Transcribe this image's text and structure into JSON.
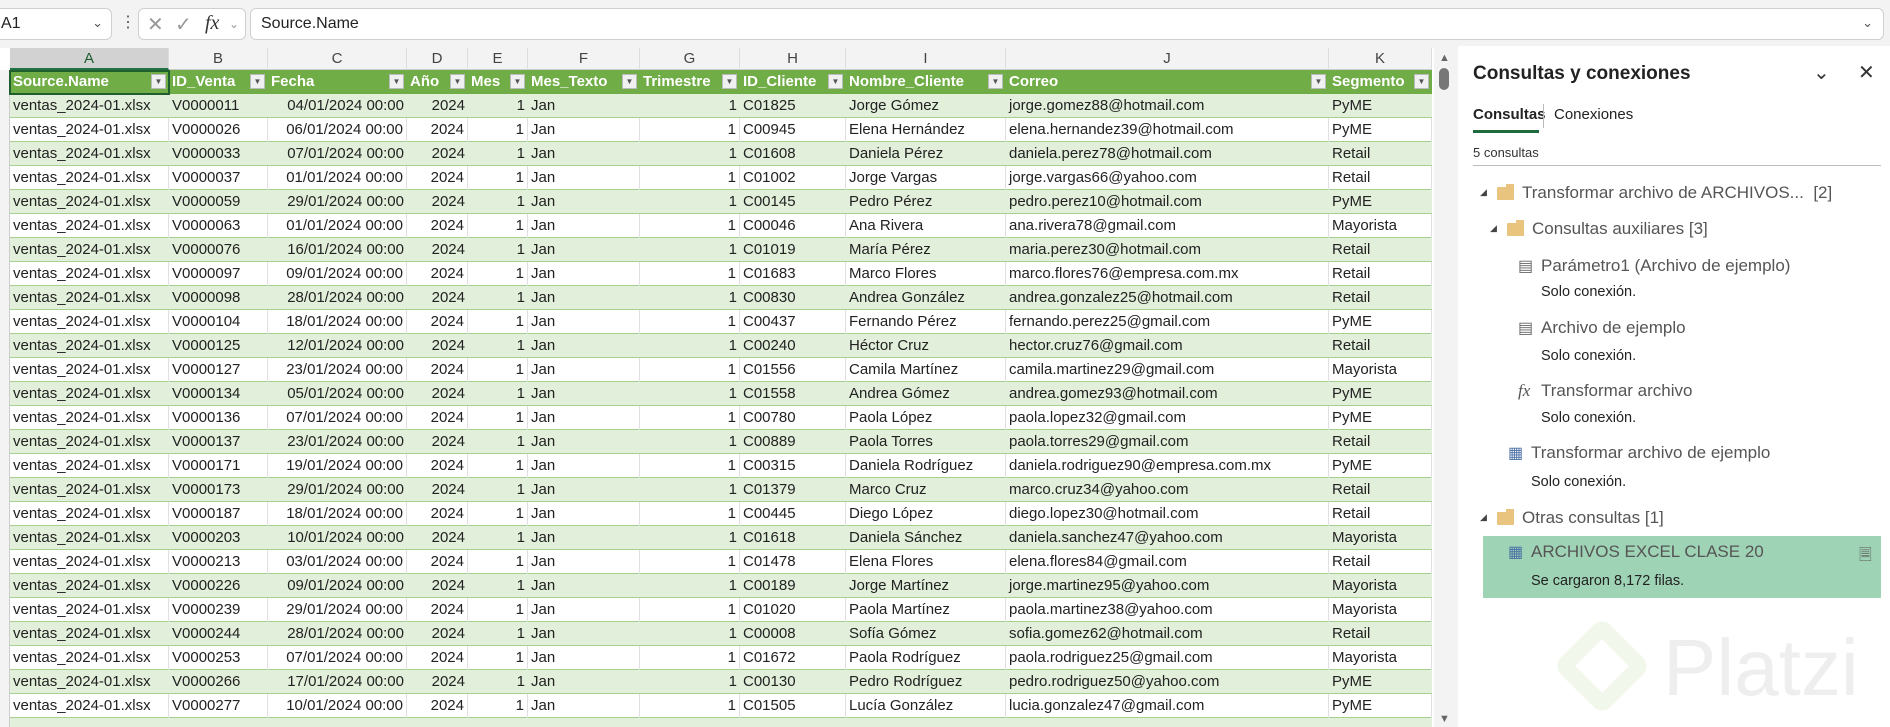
{
  "formula_bar": {
    "name_box": "A1",
    "cancel_icon": "✕",
    "enter_icon": "✓",
    "fx": "fx",
    "formula": "Source.Name"
  },
  "column_letters": [
    "A",
    "B",
    "C",
    "D",
    "E",
    "F",
    "G",
    "H",
    "I",
    "J",
    "K"
  ],
  "table": {
    "headers": [
      "Source.Name",
      "ID_Venta",
      "Fecha",
      "Año",
      "Mes",
      "Mes_Texto",
      "Trimestre",
      "ID_Cliente",
      "Nombre_Cliente",
      "Correo",
      "Segmento"
    ],
    "rows": [
      [
        "ventas_2024-01.xlsx",
        "V0000011",
        "04/01/2024 00:00",
        "2024",
        "1",
        "Jan",
        "1",
        "C01825",
        "Jorge Gómez",
        "jorge.gomez88@hotmail.com",
        "PyME"
      ],
      [
        "ventas_2024-01.xlsx",
        "V0000026",
        "06/01/2024 00:00",
        "2024",
        "1",
        "Jan",
        "1",
        "C00945",
        "Elena Hernández",
        "elena.hernandez39@hotmail.com",
        "PyME"
      ],
      [
        "ventas_2024-01.xlsx",
        "V0000033",
        "07/01/2024 00:00",
        "2024",
        "1",
        "Jan",
        "1",
        "C01608",
        "Daniela Pérez",
        "daniela.perez78@hotmail.com",
        "Retail"
      ],
      [
        "ventas_2024-01.xlsx",
        "V0000037",
        "01/01/2024 00:00",
        "2024",
        "1",
        "Jan",
        "1",
        "C01002",
        "Jorge Vargas",
        "jorge.vargas66@yahoo.com",
        "Retail"
      ],
      [
        "ventas_2024-01.xlsx",
        "V0000059",
        "29/01/2024 00:00",
        "2024",
        "1",
        "Jan",
        "1",
        "C00145",
        "Pedro Pérez",
        "pedro.perez10@hotmail.com",
        "PyME"
      ],
      [
        "ventas_2024-01.xlsx",
        "V0000063",
        "01/01/2024 00:00",
        "2024",
        "1",
        "Jan",
        "1",
        "C00046",
        "Ana Rivera",
        "ana.rivera78@gmail.com",
        "Mayorista"
      ],
      [
        "ventas_2024-01.xlsx",
        "V0000076",
        "16/01/2024 00:00",
        "2024",
        "1",
        "Jan",
        "1",
        "C01019",
        "María Pérez",
        "maria.perez30@hotmail.com",
        "Retail"
      ],
      [
        "ventas_2024-01.xlsx",
        "V0000097",
        "09/01/2024 00:00",
        "2024",
        "1",
        "Jan",
        "1",
        "C01683",
        "Marco Flores",
        "marco.flores76@empresa.com.mx",
        "Retail"
      ],
      [
        "ventas_2024-01.xlsx",
        "V0000098",
        "28/01/2024 00:00",
        "2024",
        "1",
        "Jan",
        "1",
        "C00830",
        "Andrea González",
        "andrea.gonzalez25@hotmail.com",
        "Retail"
      ],
      [
        "ventas_2024-01.xlsx",
        "V0000104",
        "18/01/2024 00:00",
        "2024",
        "1",
        "Jan",
        "1",
        "C00437",
        "Fernando Pérez",
        "fernando.perez25@gmail.com",
        "PyME"
      ],
      [
        "ventas_2024-01.xlsx",
        "V0000125",
        "12/01/2024 00:00",
        "2024",
        "1",
        "Jan",
        "1",
        "C00240",
        "Héctor Cruz",
        "hector.cruz76@gmail.com",
        "Retail"
      ],
      [
        "ventas_2024-01.xlsx",
        "V0000127",
        "23/01/2024 00:00",
        "2024",
        "1",
        "Jan",
        "1",
        "C01556",
        "Camila Martínez",
        "camila.martinez29@gmail.com",
        "Mayorista"
      ],
      [
        "ventas_2024-01.xlsx",
        "V0000134",
        "05/01/2024 00:00",
        "2024",
        "1",
        "Jan",
        "1",
        "C01558",
        "Andrea Gómez",
        "andrea.gomez93@hotmail.com",
        "PyME"
      ],
      [
        "ventas_2024-01.xlsx",
        "V0000136",
        "07/01/2024 00:00",
        "2024",
        "1",
        "Jan",
        "1",
        "C00780",
        "Paola López",
        "paola.lopez32@gmail.com",
        "PyME"
      ],
      [
        "ventas_2024-01.xlsx",
        "V0000137",
        "23/01/2024 00:00",
        "2024",
        "1",
        "Jan",
        "1",
        "C00889",
        "Paola Torres",
        "paola.torres29@gmail.com",
        "Retail"
      ],
      [
        "ventas_2024-01.xlsx",
        "V0000171",
        "19/01/2024 00:00",
        "2024",
        "1",
        "Jan",
        "1",
        "C00315",
        "Daniela Rodríguez",
        "daniela.rodriguez90@empresa.com.mx",
        "PyME"
      ],
      [
        "ventas_2024-01.xlsx",
        "V0000173",
        "29/01/2024 00:00",
        "2024",
        "1",
        "Jan",
        "1",
        "C01379",
        "Marco Cruz",
        "marco.cruz34@yahoo.com",
        "Retail"
      ],
      [
        "ventas_2024-01.xlsx",
        "V0000187",
        "18/01/2024 00:00",
        "2024",
        "1",
        "Jan",
        "1",
        "C00445",
        "Diego López",
        "diego.lopez30@hotmail.com",
        "Retail"
      ],
      [
        "ventas_2024-01.xlsx",
        "V0000203",
        "10/01/2024 00:00",
        "2024",
        "1",
        "Jan",
        "1",
        "C01618",
        "Daniela Sánchez",
        "daniela.sanchez47@yahoo.com",
        "Mayorista"
      ],
      [
        "ventas_2024-01.xlsx",
        "V0000213",
        "03/01/2024 00:00",
        "2024",
        "1",
        "Jan",
        "1",
        "C01478",
        "Elena Flores",
        "elena.flores84@gmail.com",
        "Retail"
      ],
      [
        "ventas_2024-01.xlsx",
        "V0000226",
        "09/01/2024 00:00",
        "2024",
        "1",
        "Jan",
        "1",
        "C00189",
        "Jorge Martínez",
        "jorge.martinez95@yahoo.com",
        "Mayorista"
      ],
      [
        "ventas_2024-01.xlsx",
        "V0000239",
        "29/01/2024 00:00",
        "2024",
        "1",
        "Jan",
        "1",
        "C01020",
        "Paola Martínez",
        "paola.martinez38@yahoo.com",
        "Mayorista"
      ],
      [
        "ventas_2024-01.xlsx",
        "V0000244",
        "28/01/2024 00:00",
        "2024",
        "1",
        "Jan",
        "1",
        "C00008",
        "Sofía Gómez",
        "sofia.gomez62@hotmail.com",
        "Retail"
      ],
      [
        "ventas_2024-01.xlsx",
        "V0000253",
        "07/01/2024 00:00",
        "2024",
        "1",
        "Jan",
        "1",
        "C01672",
        "Paola Rodríguez",
        "paola.rodriguez25@gmail.com",
        "Mayorista"
      ],
      [
        "ventas_2024-01.xlsx",
        "V0000266",
        "17/01/2024 00:00",
        "2024",
        "1",
        "Jan",
        "1",
        "C00130",
        "Pedro Rodríguez",
        "pedro.rodriguez50@yahoo.com",
        "PyME"
      ],
      [
        "ventas_2024-01.xlsx",
        "V0000277",
        "10/01/2024 00:00",
        "2024",
        "1",
        "Jan",
        "1",
        "C01505",
        "Lucía González",
        "lucia.gonzalez47@gmail.com",
        "PyME"
      ]
    ]
  },
  "panel": {
    "title": "Consultas y conexiones",
    "tabs": [
      "Consultas",
      "Conexiones"
    ],
    "count": "5 consultas",
    "groups": {
      "g1": {
        "label": "Transformar archivo de ARCHIVOS...",
        "count": "[2]"
      },
      "g2": {
        "label": "Consultas auxiliares",
        "count": "[3]"
      },
      "g3": {
        "label": "Otras consultas",
        "count": "[1]"
      }
    },
    "queries": [
      {
        "name": "Parámetro1 (Archivo de ejemplo)",
        "status": "Solo conexión."
      },
      {
        "name": "Archivo de ejemplo",
        "status": "Solo conexión."
      },
      {
        "name": "Transformar archivo",
        "status": "Solo conexión."
      },
      {
        "name": "Transformar archivo de ejemplo",
        "status": "Solo conexión."
      },
      {
        "name": "ARCHIVOS EXCEL CLASE 20",
        "status": "Se cargaron 8,172 filas."
      }
    ],
    "watermark": "Platzi"
  },
  "colors": {
    "header_green": "#70ad47",
    "band_green": "#e2efda",
    "selected_query": "#9fd3b5"
  }
}
